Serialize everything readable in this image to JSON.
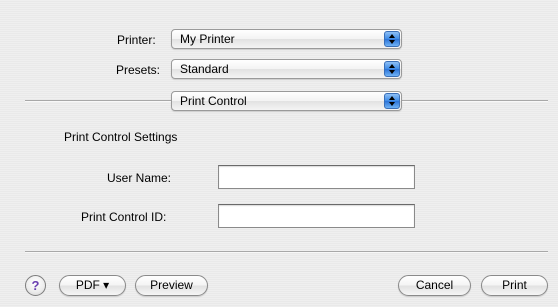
{
  "printer": {
    "label": "Printer:",
    "value": "My Printer"
  },
  "presets": {
    "label": "Presets:",
    "value": "Standard"
  },
  "panel": {
    "value": "Print Control"
  },
  "section": {
    "title": "Print Control Settings"
  },
  "fields": {
    "user_name": {
      "label": "User Name:",
      "value": ""
    },
    "print_control_id": {
      "label": "Print Control ID:",
      "value": ""
    }
  },
  "buttons": {
    "help": "?",
    "pdf": "PDF ▾",
    "preview": "Preview",
    "cancel": "Cancel",
    "print": "Print"
  },
  "icons": {
    "popup": "up-down-arrows-icon",
    "help": "help-icon"
  },
  "colors": {
    "accent": "#3d8ae6"
  }
}
